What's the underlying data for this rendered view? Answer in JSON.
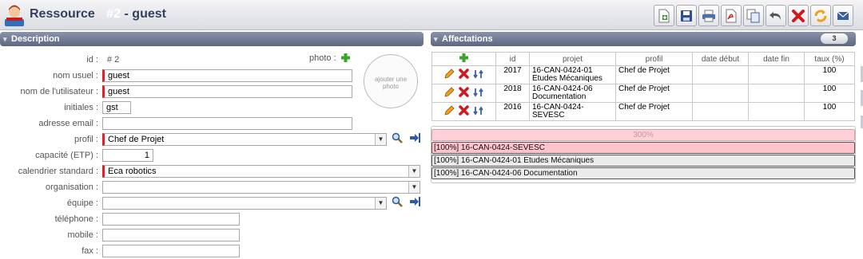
{
  "header": {
    "title": "Ressource",
    "number": "#2",
    "name_suffix": "- guest"
  },
  "toolbar": {
    "buttons": [
      "new-icon",
      "save-icon",
      "print-icon",
      "pdf-icon",
      "copy-icon",
      "undo-icon",
      "delete-icon",
      "refresh-icon",
      "mail-icon"
    ]
  },
  "description": {
    "title": "Description",
    "photo_label": "photo :",
    "photo_placeholder_line1": "ajouter une",
    "photo_placeholder_line2": "photo",
    "fields": {
      "id_label": "id :",
      "id_value": "# 2",
      "nom_usuel_label": "nom usuel :",
      "nom_usuel_value": "guest",
      "nom_utilisateur_label": "nom de l'utilisateur :",
      "nom_utilisateur_value": "guest",
      "initiales_label": "initiales :",
      "initiales_value": "gst",
      "email_label": "adresse email :",
      "email_value": "",
      "profil_label": "profil :",
      "profil_value": "Chef de Projet",
      "capacite_label": "capacité (ETP) :",
      "capacite_value": "1",
      "calendrier_label": "calendrier standard :",
      "calendrier_value": "Eca robotics",
      "organisation_label": "organisation :",
      "organisation_value": "",
      "equipe_label": "équipe :",
      "equipe_value": "",
      "telephone_label": "téléphone :",
      "telephone_value": "",
      "mobile_label": "mobile :",
      "mobile_value": "",
      "fax_label": "fax :",
      "fax_value": ""
    }
  },
  "affectations": {
    "title": "Affectations",
    "count": "3",
    "columns": [
      "id",
      "projet",
      "profil",
      "date début",
      "date fin",
      "taux (%)"
    ],
    "rows": [
      {
        "id": "2017",
        "projet_line1": "16-CAN-0424-01",
        "projet_line2": "Etudes Mécaniques",
        "profil": "Chef de Projet",
        "date_debut": "",
        "date_fin": "",
        "taux": "100"
      },
      {
        "id": "2018",
        "projet_line1": "16-CAN-0424-06",
        "projet_line2": "Documentation",
        "profil": "Chef de Projet",
        "date_debut": "",
        "date_fin": "",
        "taux": "100"
      },
      {
        "id": "2016",
        "projet_line1": "16-CAN-0424-",
        "projet_line2": "SEVESC",
        "profil": "Chef de Projet",
        "date_debut": "",
        "date_fin": "",
        "taux": "100"
      }
    ],
    "summary_total": "300%",
    "summary_lines": [
      "[100%] 16-CAN-0424-SEVESC",
      "[100%] 16-CAN-0424-01 Etudes Mécaniques",
      "[100%] 16-CAN-0424-06 Documentation"
    ]
  },
  "colors": {
    "header_bg": "#dcdde2",
    "section_head": "#6c7590",
    "required_marker": "#e0202a",
    "overload_bar": "#ffc3cd"
  }
}
